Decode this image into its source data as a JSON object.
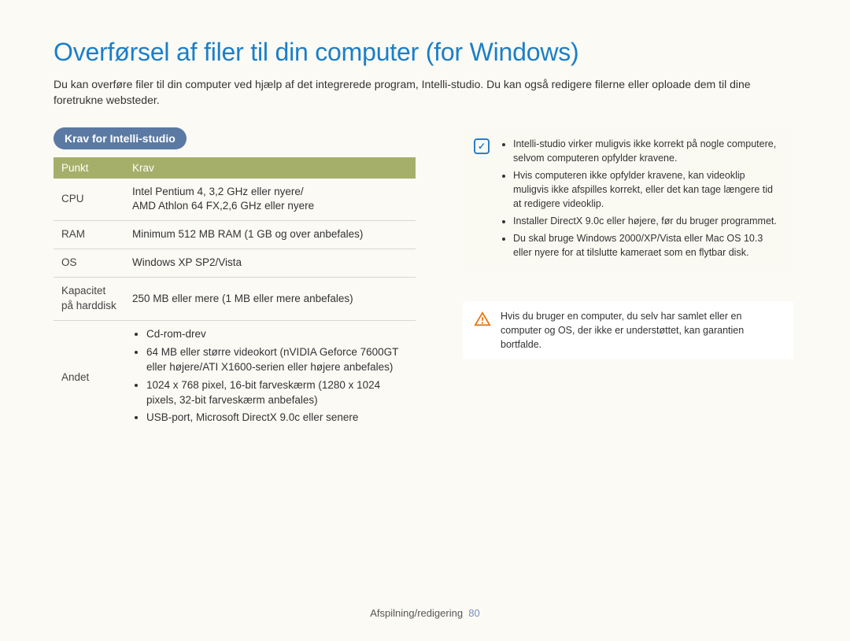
{
  "title": "Overførsel af filer til din computer (for Windows)",
  "intro": "Du kan overføre filer til din computer ved hjælp af det integrerede program, Intelli-studio. Du kan også redigere filerne eller oploade dem til dine foretrukne websteder.",
  "section_badge": "Krav for Intelli-studio",
  "table": {
    "headers": {
      "col1": "Punkt",
      "col2": "Krav"
    },
    "rows": {
      "cpu_label": "CPU",
      "cpu_value1": "Intel Pentium 4, 3,2 GHz eller nyere/",
      "cpu_value2": "AMD Athlon 64 FX,2,6 GHz eller nyere",
      "ram_label": "RAM",
      "ram_value": "Minimum 512 MB RAM (1 GB og over anbefales)",
      "os_label": "OS",
      "os_value": "Windows XP SP2/Vista",
      "cap_label1": "Kapacitet",
      "cap_label2": "på harddisk",
      "cap_value": "250 MB eller mere (1 MB eller mere anbefales)",
      "other_label": "Andet",
      "other_bullets": [
        "Cd-rom-drev",
        "64 MB eller større videokort (nVIDIA Geforce 7600GT eller højere/ATI X1600-serien eller højere anbefales)",
        "1024 x 768 pixel, 16-bit farveskærm (1280 x 1024 pixels, 32-bit farveskærm anbefales)",
        "USB-port, Microsoft DirectX 9.0c eller senere"
      ]
    }
  },
  "info_notes": [
    "Intelli-studio virker muligvis ikke korrekt på nogle computere, selvom computeren opfylder kravene.",
    "Hvis computeren ikke opfylder kravene, kan videoklip muligvis ikke afspilles korrekt, eller det kan tage længere tid at redigere videoklip.",
    "Installer DirectX 9.0c eller højere, før du bruger programmet.",
    "Du skal bruge Windows 2000/XP/Vista eller Mac OS 10.3 eller nyere for at tilslutte kameraet som en flytbar disk."
  ],
  "warn_note": "Hvis du bruger en computer, du selv har samlet eller en computer og OS, der ikke er understøttet, kan garantien bortfalde.",
  "footer": {
    "section": "Afspilning/redigering",
    "page": "80"
  }
}
